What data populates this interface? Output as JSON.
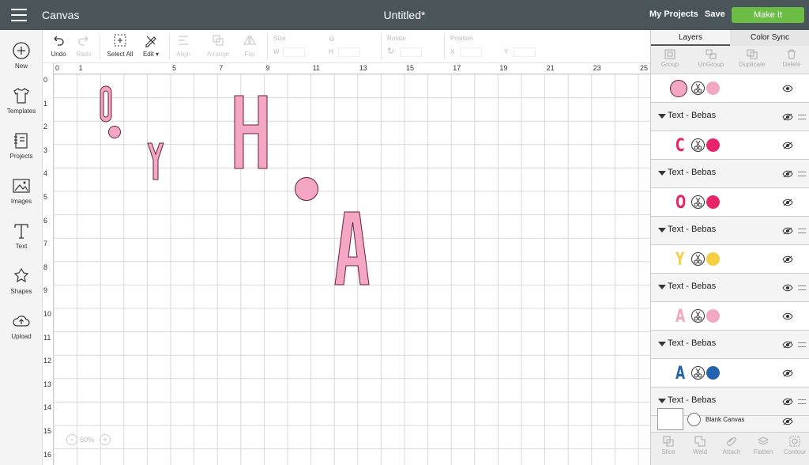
{
  "header": {
    "app_title": "Canvas",
    "doc_title": "Untitled*",
    "my_projects": "My Projects",
    "save": "Save",
    "make_it": "Make It",
    "accent": "#6cbd45",
    "bar_color": "#4a5559"
  },
  "sidebar": {
    "items": [
      {
        "label": "New",
        "icon": "plus-circle-icon"
      },
      {
        "label": "Templates",
        "icon": "shirt-icon"
      },
      {
        "label": "Projects",
        "icon": "notebook-icon"
      },
      {
        "label": "Images",
        "icon": "image-icon"
      },
      {
        "label": "Text",
        "icon": "text-t-icon"
      },
      {
        "label": "Shapes",
        "icon": "shapes-icon"
      },
      {
        "label": "Upload",
        "icon": "cloud-upload-icon"
      }
    ]
  },
  "toolbar": {
    "undo": "Undo",
    "redo": "Redo",
    "select_all": "Select All",
    "edit": "Edit",
    "align": "Align",
    "arrange": "Arrange",
    "flip": "Flip",
    "size": "Size",
    "w": "W",
    "h": "H",
    "rotate": "Rotate",
    "position": "Position",
    "x": "X",
    "y": "Y"
  },
  "canvas": {
    "ruler_top": [
      "0",
      "1",
      "",
      "",
      "",
      "5",
      "",
      "7",
      "",
      "9",
      "",
      "11",
      "",
      "13",
      "",
      "15",
      "",
      "17",
      "",
      "19",
      "",
      "21",
      "",
      "23",
      "",
      "25"
    ],
    "ruler_left": [
      "0",
      "1",
      "2",
      "3",
      "4",
      "5",
      "6",
      "7",
      "8",
      "9",
      "10",
      "11",
      "12",
      "13",
      "14",
      "15",
      "16"
    ],
    "zoom": "50%",
    "shapes": [
      {
        "char": "O",
        "color": "#f4a7c4"
      },
      {
        "char": "Y",
        "color": "#f4a7c4"
      },
      {
        "char": "H",
        "color": "#f4a7c4"
      },
      {
        "char": "A",
        "color": "#f4a7c4"
      }
    ]
  },
  "panel": {
    "tab_layers": "Layers",
    "tab_color_sync": "Color Sync",
    "tools": {
      "group": "Group",
      "ungroup": "UnGroup",
      "duplicate": "Duplicate",
      "delete": "Delete"
    },
    "layers": [
      {
        "kind": "item",
        "letter": "",
        "color": "#f4a7c4",
        "visible": true,
        "shape": "circle"
      },
      {
        "kind": "group",
        "name": "Text - Bebas",
        "visible": false
      },
      {
        "kind": "item",
        "letter": "C",
        "color": "#e8246a",
        "visible": false
      },
      {
        "kind": "group",
        "name": "Text - Bebas",
        "visible": false
      },
      {
        "kind": "item",
        "letter": "O",
        "color": "#e8246a",
        "visible": false
      },
      {
        "kind": "group",
        "name": "Text - Bebas",
        "visible": false
      },
      {
        "kind": "item",
        "letter": "Y",
        "color": "#f7cd42",
        "visible": false
      },
      {
        "kind": "group",
        "name": "Text - Bebas",
        "visible": true
      },
      {
        "kind": "item",
        "letter": "A",
        "color": "#f4a7c4",
        "visible": true
      },
      {
        "kind": "group",
        "name": "Text - Bebas",
        "visible": false
      },
      {
        "kind": "item",
        "letter": "A",
        "color": "#2362ad",
        "visible": false
      },
      {
        "kind": "group",
        "name": "Text - Bebas",
        "visible": false
      }
    ],
    "blank_canvas": "Blank Canvas",
    "bottom": {
      "slice": "Slice",
      "weld": "Weld",
      "attach": "Attach",
      "flatten": "Flatten",
      "contour": "Contour"
    }
  }
}
